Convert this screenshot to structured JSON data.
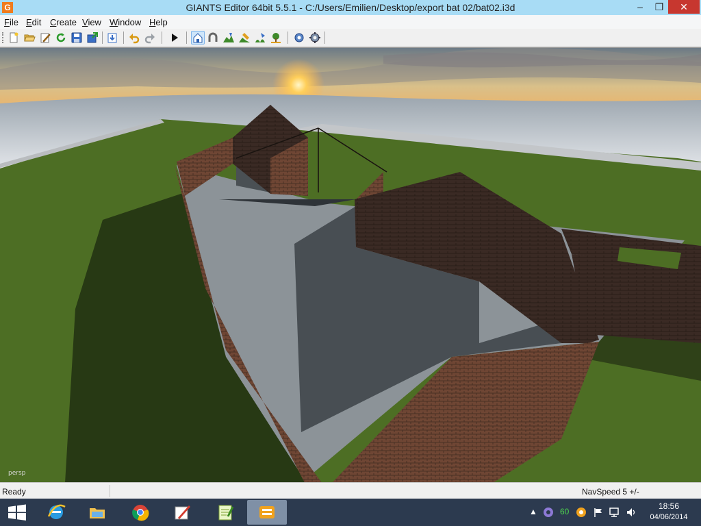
{
  "window": {
    "title": "GIANTS Editor 64bit 5.5.1 - C:/Users/Emilien/Desktop/export bat 02/bat02.i3d",
    "app_icon_letter": "G",
    "controls": {
      "minimize": "–",
      "maximize": "❐",
      "close": "✕"
    }
  },
  "menu": {
    "items": [
      {
        "first": "F",
        "rest": "ile"
      },
      {
        "first": "E",
        "rest": "dit"
      },
      {
        "first": "C",
        "rest": "reate"
      },
      {
        "first": "V",
        "rest": "iew"
      },
      {
        "first": "W",
        "rest": "indow"
      },
      {
        "first": "H",
        "rest": "elp"
      }
    ]
  },
  "toolbar": {
    "icons": [
      "new-file-icon",
      "open-folder-icon",
      "edit-icon",
      "refresh-icon",
      "save-icon",
      "export-icon",
      "import-icon",
      "undo-icon",
      "redo-icon",
      "play-icon",
      "home-view-icon",
      "magnet-icon",
      "terrain-sculpt-icon",
      "terrain-paint-icon",
      "foliage-paint-icon",
      "tree-placement-icon",
      "scripts-icon",
      "settings-icon"
    ],
    "active_tool": "home-view-icon"
  },
  "viewport": {
    "camera_label": "persp"
  },
  "status": {
    "left": "Ready",
    "navspeed": "NavSpeed 5 +/-"
  },
  "taskbar": {
    "apps": [
      "internet-explorer",
      "file-explorer",
      "chrome",
      "paint-app",
      "notepad-plus",
      "giants-editor"
    ],
    "active_app": "giants-editor",
    "tray": {
      "arrow": "▲",
      "counter": "60"
    },
    "clock": {
      "time": "18:56",
      "date": "04/06/2014"
    }
  },
  "colors": {
    "titlebar": "#a8dcf5",
    "close_button": "#c7372f",
    "taskbar": "#2c3a4f",
    "grass": "#4d6e24",
    "brick": "#6f4634",
    "concrete": "#8c9398"
  }
}
